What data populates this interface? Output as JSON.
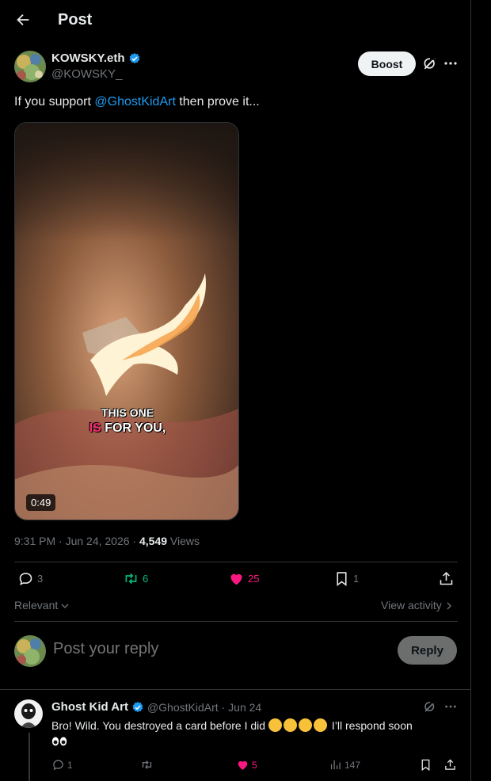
{
  "header": {
    "title": "Post"
  },
  "post": {
    "author_name": "KOWSKY.eth",
    "author_handle": "@KOWSKY_",
    "boost_label": "Boost",
    "text_before": "If you support ",
    "mention": "@GhostKidArt",
    "text_after": " then prove it...",
    "video": {
      "caption_line1": "THIS ONE",
      "caption_highlight": "IS",
      "caption_rest": " FOR YOU,",
      "duration": "0:49"
    },
    "timestamp": "9:31 PM · Jun 24, 2026 · ",
    "views_count": "4,549",
    "views_label": " Views",
    "stats": {
      "replies": "3",
      "reposts": "6",
      "likes": "25",
      "bookmarks": "1"
    },
    "colors": {
      "repost": "#00ba7c",
      "like": "#f91880",
      "link": "#1d9bf0"
    }
  },
  "sort_label": "Relevant",
  "view_activity_label": "View activity",
  "composer": {
    "placeholder": "Post your reply",
    "reply_label": "Reply"
  },
  "reply": {
    "author_name": "Ghost Kid Art",
    "author_handle": "@GhostKidArt",
    "date": "· Jun 24",
    "text": "Bro! Wild. You destroyed a card before I did",
    "text_after": " I’ll respond soon",
    "stats": {
      "replies": "1",
      "likes": "5",
      "views": "147"
    }
  },
  "icons": [
    "back-arrow-icon",
    "verified-icon",
    "grok-icon",
    "more-icon",
    "reply-icon",
    "repost-icon",
    "like-icon",
    "bookmark-icon",
    "share-icon",
    "chevron-down-icon",
    "chevron-right-icon",
    "views-icon",
    "laughing-emoji-icon",
    "eyes-emoji-icon"
  ]
}
